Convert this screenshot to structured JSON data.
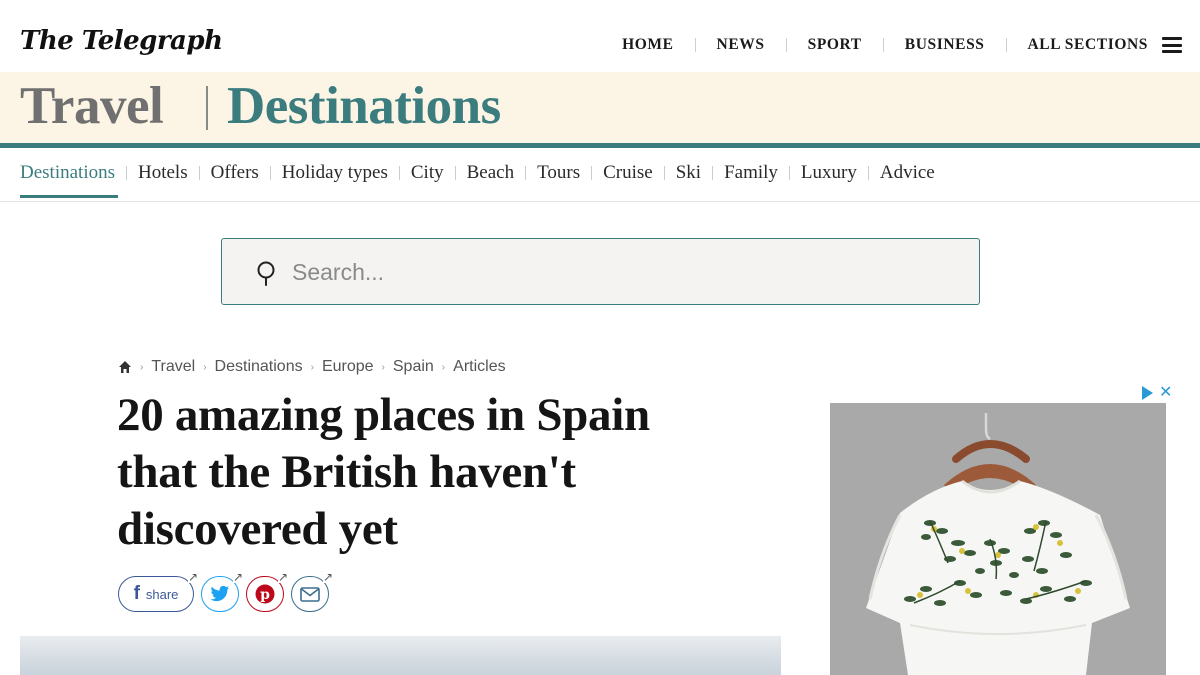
{
  "header": {
    "logo": "The Telegraph",
    "nav": [
      "HOME",
      "NEWS",
      "SPORT",
      "BUSINESS",
      "ALL SECTIONS"
    ],
    "menu_icon": "hamburger-menu-icon"
  },
  "banner": {
    "section": "Travel",
    "subsection": "Destinations"
  },
  "subnav": {
    "active": "Destinations",
    "items": [
      "Destinations",
      "Hotels",
      "Offers",
      "Holiday types",
      "City",
      "Beach",
      "Tours",
      "Cruise",
      "Ski",
      "Family",
      "Luxury",
      "Advice"
    ]
  },
  "search": {
    "placeholder": "Search...",
    "value": "",
    "icon": "search-icon"
  },
  "breadcrumb": {
    "home_icon": "home-icon",
    "items": [
      "Travel",
      "Destinations",
      "Europe",
      "Spain",
      "Articles"
    ]
  },
  "article": {
    "headline_lines": [
      "20 amazing places in Spain",
      "that the British haven't",
      "discovered yet"
    ]
  },
  "share": {
    "facebook_label": "share",
    "facebook_glyph": "f",
    "icons": [
      "facebook-icon",
      "twitter-icon",
      "pinterest-icon",
      "email-icon"
    ]
  },
  "ad": {
    "choices_icon": "adchoices-icon",
    "close_glyph": "✕"
  },
  "colors": {
    "accent": "#3b7c7f",
    "banner_bg": "#fcf5e5",
    "facebook": "#3b5998",
    "twitter": "#1da1f2",
    "pinterest": "#bd081c"
  }
}
